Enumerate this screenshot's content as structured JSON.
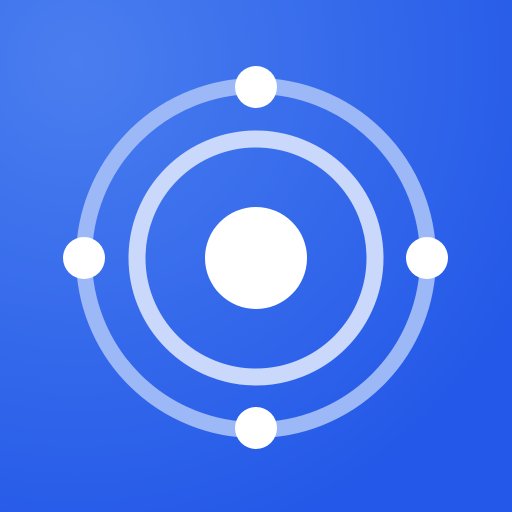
{
  "icon": {
    "name": "orbit-icon",
    "colors": {
      "background_light": "#4a7eef",
      "background_dark": "#2358e8",
      "outer_ring": "#9db8f7",
      "inner_ring": "#c9d8fb",
      "glyph": "#ffffff"
    }
  }
}
